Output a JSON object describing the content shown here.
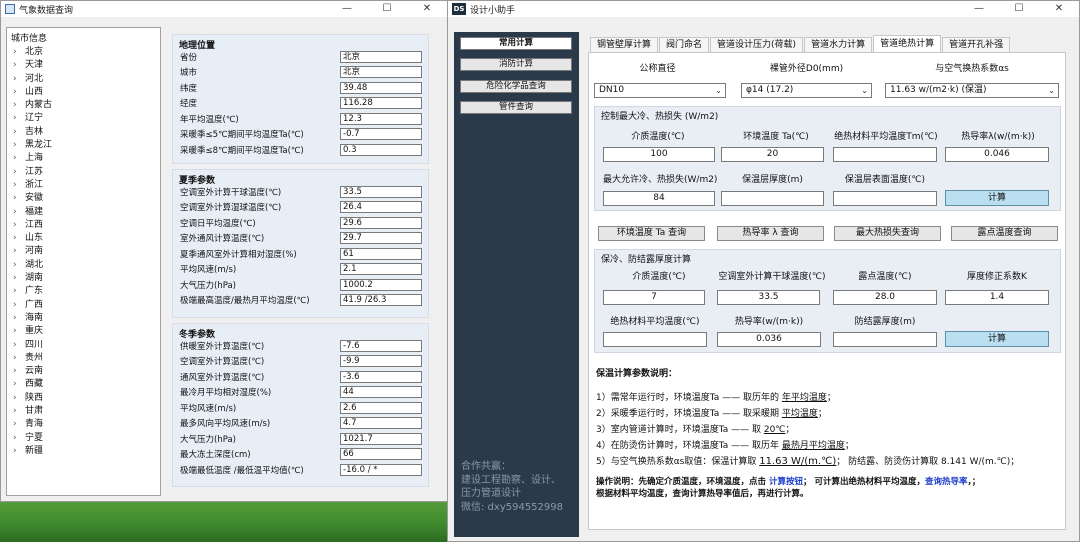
{
  "left_window": {
    "title": "气象数据查询",
    "city_header": "城市信息",
    "cities": [
      "北京",
      "天津",
      "河北",
      "山西",
      "内蒙古",
      "辽宁",
      "吉林",
      "黑龙江",
      "上海",
      "江苏",
      "浙江",
      "安徽",
      "福建",
      "江西",
      "山东",
      "河南",
      "湖北",
      "湖南",
      "广东",
      "广西",
      "海南",
      "重庆",
      "四川",
      "贵州",
      "云南",
      "西藏",
      "陕西",
      "甘肃",
      "青海",
      "宁夏",
      "新疆"
    ],
    "geo": {
      "title": "地理位置",
      "rows": [
        {
          "label": "省份",
          "value": "北京"
        },
        {
          "label": "城市",
          "value": "北京"
        },
        {
          "label": "纬度",
          "value": "39.48"
        },
        {
          "label": "经度",
          "value": "116.28"
        },
        {
          "label": "年平均温度(℃)",
          "value": "12.3"
        },
        {
          "label": "采暖季≤5℃期间平均温度Ta(℃)",
          "value": "-0.7"
        },
        {
          "label": "采暖季≤8℃期间平均温度Ta(℃)",
          "value": "0.3"
        }
      ]
    },
    "summer": {
      "title": "夏季参数",
      "rows": [
        {
          "label": "空调室外计算干球温度(℃)",
          "value": "33.5"
        },
        {
          "label": "空调室外计算湿球温度(℃)",
          "value": "26.4"
        },
        {
          "label": "空调日平均温度(℃)",
          "value": "29.6"
        },
        {
          "label": "室外通风计算温度(℃)",
          "value": "29.7"
        },
        {
          "label": "夏季通风室外计算相对湿度(%)",
          "value": "61"
        },
        {
          "label": "平均风速(m/s)",
          "value": "2.1"
        },
        {
          "label": "大气压力(hPa)",
          "value": "1000.2"
        },
        {
          "label": "极端最高温度/最热月平均温度(℃)",
          "value": "41.9 /26.3"
        }
      ]
    },
    "winter": {
      "title": "冬季参数",
      "rows": [
        {
          "label": "供暖室外计算温度(℃)",
          "value": "-7.6"
        },
        {
          "label": "空调室外计算温度(℃)",
          "value": "-9.9"
        },
        {
          "label": "通风室外计算温度(℃)",
          "value": "-3.6"
        },
        {
          "label": "最冷月平均相对湿度(%)",
          "value": "44"
        },
        {
          "label": "平均风速(m/s)",
          "value": "2.6"
        },
        {
          "label": "最多风向平均风速(m/s)",
          "value": "4.7"
        },
        {
          "label": "大气压力(hPa)",
          "value": "1021.7"
        },
        {
          "label": "最大冻土深度(cm)",
          "value": "66"
        },
        {
          "label": "极端最低温度 /最低温平均值(℃)",
          "value": "-16.0 / *"
        }
      ]
    }
  },
  "right_window": {
    "title": "设计小助手",
    "app_icon": "DS",
    "sidebar": {
      "buttons": [
        "常用计算",
        "消防计算",
        "危险化学品查询",
        "管件查询"
      ],
      "footer": [
        "合作共赢：",
        "建设工程勘察、设计、",
        "压力管道设计",
        "微信: dxy594552998"
      ]
    },
    "tabs": [
      "钢管壁厚计算",
      "阀门命名",
      "管道设计压力(荷载)",
      "管道水力计算",
      "管道绝热计算",
      "管道开孔补强"
    ],
    "top": {
      "labels": [
        "公称直径",
        "裸管外径D0(mm)",
        "与空气换热系数αs"
      ],
      "values": [
        "DN10",
        "φ14 (17.2)",
        "11.63 w/(m2·k)  (保温)"
      ]
    },
    "heat_loss": {
      "title": "控制最大冷、热损失 (W/m2)",
      "labels1": [
        "介质温度(℃)",
        "环境温度 Ta(℃)",
        "绝热材料平均温度Tm(℃)",
        "热导率λ(w/(m·k))"
      ],
      "values1": [
        "100",
        "20",
        "",
        "0.046"
      ],
      "labels2": [
        "最大允许冷、热损失(W/m2)",
        "保温层厚度(m)",
        "保温层表面温度(℃)"
      ],
      "values2": [
        "84",
        "",
        ""
      ],
      "calc": "计算"
    },
    "query_buttons": [
      "环境温度 Ta 查询",
      "热导率 λ 查询",
      "最大热损失查询",
      "露点温度查询"
    ],
    "cond": {
      "title": "保冷、防结露厚度计算",
      "labels1": [
        "介质温度(℃)",
        "空调室外计算干球温度(℃)",
        "露点温度(℃)",
        "厚度修正系数K"
      ],
      "values1": [
        "7",
        "33.5",
        "28.0",
        "1.4"
      ],
      "labels2": [
        "绝热材料平均温度(℃)",
        "热导率(w/(m·k))",
        "防结露厚度(m)"
      ],
      "values2": [
        "",
        "0.036",
        ""
      ],
      "calc": "计算"
    },
    "notes": {
      "title": "保温计算参数说明：",
      "l1a": "1）需常年运行时，环境温度Ta —— 取历年的 ",
      "l1b": "年平均温度",
      "l1c": "；",
      "l2a": "2）采暖季运行时，环境温度Ta —— 取采暖期 ",
      "l2b": "平均温度",
      "l2c": "；",
      "l3a": "3）室内管道计算时，环境温度Ta —— 取 ",
      "l3b": "20℃",
      "l3c": "；",
      "l4a": "4）在防烫伤计算时，环境温度Ta —— 取历年 ",
      "l4b": "最热月平均温度",
      "l4c": "；",
      "l5a": "5）与空气换热系数αs取值：保温计算取 ",
      "l5b": "11.63 W/(m.℃)",
      "l5c": "；  防结露、防烫伤计算取 8.141 W/(m.℃)；",
      "tip1a": "操作说明：先确定介质温度，环境温度，点击 ",
      "tip1b": "计算按钮",
      "tip1c": "；  可计算出绝热材料平均温度，",
      "tip1d": "查询热导率",
      "tip1e": "，；",
      "tip2": "根据材料平均温度，查询计算热导率值后，再进行计算。"
    }
  }
}
